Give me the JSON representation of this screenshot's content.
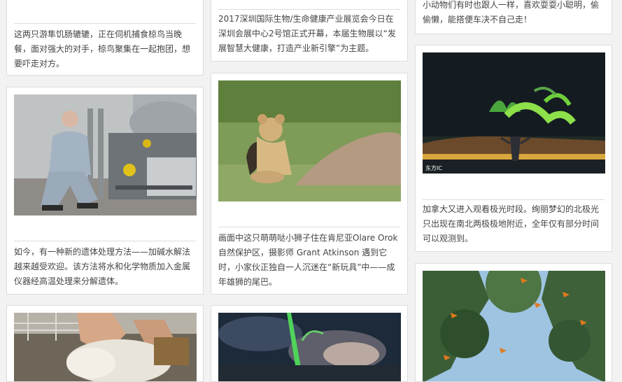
{
  "cards": [
    {
      "caption": "这两只游隼饥肠辘辘，正在伺机捕食椋鸟当晚餐，面对强大的对手，椋鸟聚集在一起抱团，想要吓走对方。"
    },
    {
      "caption": "2017深圳国际生物/生命健康产业展览会今日在深圳会展中心2号馆正式开幕，本届生物展以“发展智慧大健康，打造产业新引擎”为主题。"
    },
    {
      "caption": "小动物们有时也跟人一样，喜欢耍耍小聪明，偷偷懒，能搭便车决不自己走！"
    },
    {
      "caption": "如今，有一种新的遗体处理方法——加碱水解法越来越受欢迎。该方法将水和化学物质加入金属仪器经高温处理来分解遗体。",
      "image": "man-kneeling-by-lab-equipment"
    },
    {
      "caption": "画面中这只萌萌哒小狮子住在肯尼亚Olare Orok自然保护区，摄影师 Grant Atkinson 遇到它时，小家伙正独自一人沉迷在“新玩具”中——成年雄狮的尾巴。",
      "image": "lion-cub-with-tail"
    },
    {
      "caption": "加拿大又进入观看极光时段。绚丽梦幻的北极光只出现在南北两极极地附近，全年仅有部分时间可以观测到。",
      "image": "northern-lights",
      "watermark": "东方IC"
    },
    {
      "image": "sheep-shearing"
    },
    {
      "image": "aurora-night"
    },
    {
      "image": "butterflies-trees"
    }
  ]
}
